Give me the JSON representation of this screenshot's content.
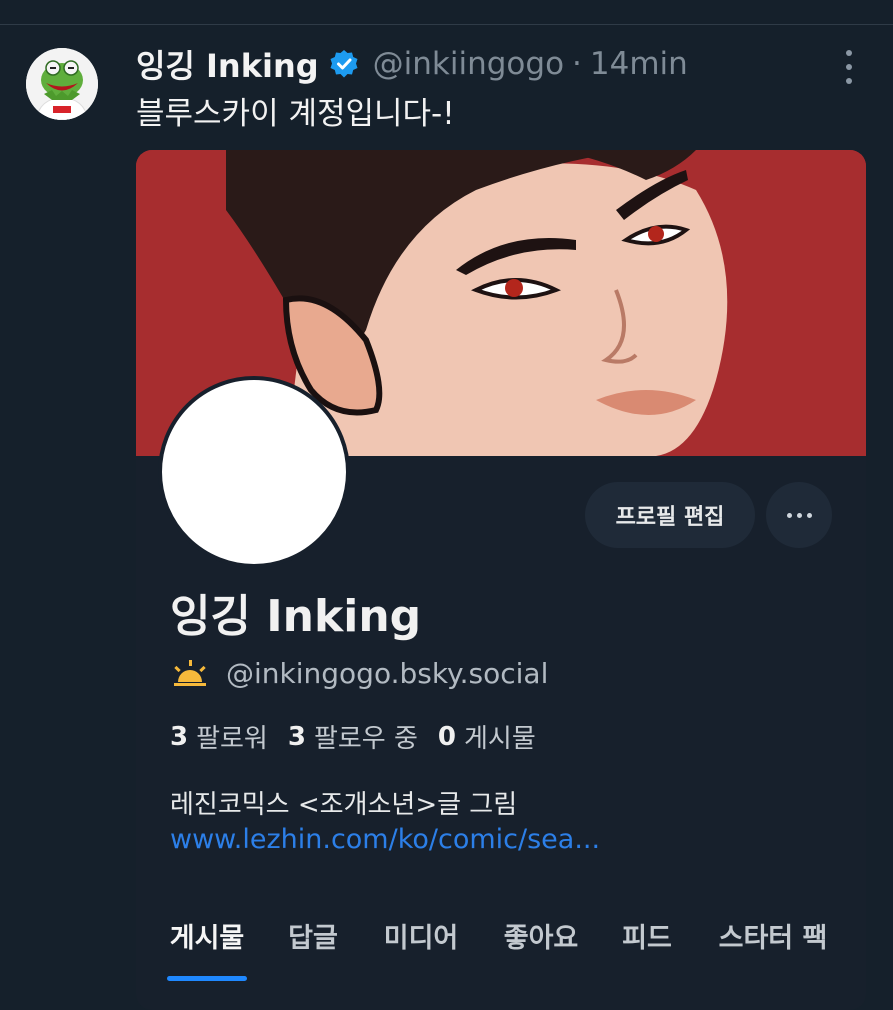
{
  "tweet": {
    "display_name": "잉깅 Inking",
    "handle": "@inkiingogo",
    "separator": "·",
    "time": "14min",
    "text": "블루스카이 계정입니다-!",
    "verified_icon": "verified-badge-icon",
    "avatar_icon": "kermit-avatar",
    "more_icon": "more-vertical-icon"
  },
  "card": {
    "banner_image": "illustrated-man-red-background",
    "profile_name": "잉깅 Inking",
    "profile_handle": "@inkingogo.bsky.social",
    "handle_icon": "sun-icon",
    "edit_button": "프로필 편집",
    "more_button_icon": "more-horizontal-icon",
    "stats": [
      {
        "value": "3",
        "label": "팔로워"
      },
      {
        "value": "3",
        "label": "팔로우 중"
      },
      {
        "value": "0",
        "label": "게시물"
      }
    ],
    "bio": "레진코믹스 <조개소년>글 그림",
    "link": "www.lezhin.com/ko/comic/sea...",
    "tabs": [
      {
        "label": "게시물",
        "active": true
      },
      {
        "label": "답글"
      },
      {
        "label": "미디어"
      },
      {
        "label": "좋아요"
      },
      {
        "label": "피드"
      },
      {
        "label": "스타터 팩"
      }
    ],
    "colors": {
      "background": "#15202b",
      "banner": "#a72d2f",
      "link": "#2c7fe8",
      "verified": "#1d9bf0",
      "tab_indicator": "#1f88ff"
    }
  }
}
